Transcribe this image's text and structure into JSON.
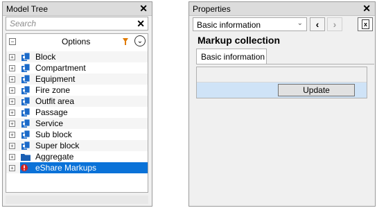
{
  "model_tree": {
    "title": "Model Tree",
    "close_glyph": "✕",
    "search_placeholder": "Search",
    "search_clear_glyph": "✕",
    "options_label": "Options",
    "collapse_glyph": "−",
    "chevron_glyph": "⌄",
    "expander_glyph": "+",
    "items": [
      {
        "label": "Block",
        "icon": "object-icon"
      },
      {
        "label": "Compartment",
        "icon": "object-icon"
      },
      {
        "label": "Equipment",
        "icon": "object-icon"
      },
      {
        "label": "Fire zone",
        "icon": "object-icon"
      },
      {
        "label": "Outfit area",
        "icon": "object-icon"
      },
      {
        "label": "Passage",
        "icon": "object-icon"
      },
      {
        "label": "Service",
        "icon": "object-icon"
      },
      {
        "label": "Sub block",
        "icon": "object-icon"
      },
      {
        "label": "Super block",
        "icon": "object-icon"
      },
      {
        "label": "Aggregate",
        "icon": "folder-icon"
      },
      {
        "label": "eShare Markups",
        "icon": "markup-icon",
        "selected": true
      }
    ],
    "colors": {
      "selection": "#0a72d8",
      "object_icon": "#1b6ac9",
      "folder_icon": "#1a5fb4",
      "markup_icon": "#d21f1f",
      "filter_icon": "#e07a00"
    }
  },
  "properties": {
    "title": "Properties",
    "close_glyph": "✕",
    "view_select_value": "Basic information",
    "select_arrow_glyph": "⌄",
    "prev_glyph": "‹",
    "next_glyph": "›",
    "export_icon_glyph": "x",
    "section_title": "Markup collection",
    "tab_label": "Basic information",
    "update_button_label": "Update",
    "colors": {
      "grid_selected_row": "#cfe3f7"
    }
  }
}
